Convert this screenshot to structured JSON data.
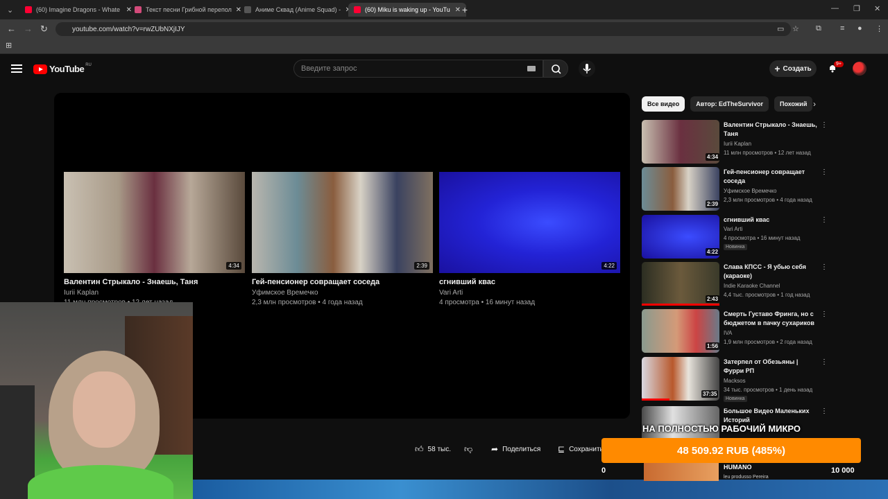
{
  "browser": {
    "tabs": [
      {
        "label": "(60) Imagine Dragons - Whate",
        "favcolor": "#ff0033",
        "active": false
      },
      {
        "label": "Текст песни Грибной перепол",
        "favcolor": "#d34b7a",
        "active": false
      },
      {
        "label": "Аниме Сквад (Anime Squad) -",
        "favcolor": "#2b2b2b",
        "active": false
      },
      {
        "label": "(60) Miku is waking up - YouTu",
        "favcolor": "#ff0033",
        "active": true
      }
    ],
    "url": "youtube.com/watch?v=rwZUbNXjIJY"
  },
  "header": {
    "logo_text": "YouTube",
    "region": "RU",
    "search_placeholder": "Введите запрос",
    "create_label": "Создать",
    "notif_badge": "9+"
  },
  "endcards": [
    {
      "title": "Валентин Стрыкало - Знаешь, Таня",
      "channel": "Iurii Kaplan",
      "meta": "11 млн просмотров • 12 лет назад",
      "duration": "4:34"
    },
    {
      "title": "Гей-пенсионер совращает соседа",
      "channel": "Уфимское Времечко",
      "meta": "2,3 млн просмотров • 4 года назад",
      "duration": "2:39"
    },
    {
      "title": "сгнивший квас",
      "channel": "Vari Arti",
      "meta": "4 просмотра • 16 минут назад",
      "duration": "4:22"
    }
  ],
  "actions": {
    "likes": "58 тыс.",
    "share": "Поделиться",
    "save": "Сохранить"
  },
  "chips": [
    "Все видео",
    "Автор: EdTheSurvivor",
    "Похожий"
  ],
  "recommendations": [
    {
      "title": "Валентин Стрыкало - Знаешь, Таня",
      "channel": "Iurii Kaplan",
      "meta": "11 млн просмотров • 12 лет назад",
      "duration": "4:34",
      "badge": ""
    },
    {
      "title": "Гей-пенсионер совращает соседа",
      "channel": "Уфимское Времечко",
      "meta": "2,3 млн просмотров • 4 года назад",
      "duration": "2:39",
      "badge": ""
    },
    {
      "title": "сгнивший квас",
      "channel": "Vari Arti",
      "meta": "4 просмотра • 16 минут назад",
      "duration": "4:22",
      "badge": "Новинка"
    },
    {
      "title": "Слава КПСС - Я убью себя (караоке)",
      "channel": "Indie Karaoke Channel",
      "meta": "4,4 тыс. просмотров • 1 год назад",
      "duration": "2:43",
      "badge": ""
    },
    {
      "title": "Смерть Густаво Фринга, но с бюджетом в пачку сухариков",
      "channel": "IVA",
      "meta": "1,9 млн просмотров • 2 года назад",
      "duration": "1:56",
      "badge": ""
    },
    {
      "title": "Затерпел от Обезьяны | Фурри РП",
      "channel": "Macksos",
      "meta": "34 тыс. просмотров • 1 день назад",
      "duration": "37:35",
      "badge": "Новинка"
    },
    {
      "title": "Большое Видео Маленьких Историй",
      "channel": "",
      "meta": "",
      "duration": "",
      "badge": ""
    }
  ],
  "overlay": {
    "donate_text": "НА ПОЛНОСТЬЮ РАБОЧИЙ МИКРО",
    "donate_amount": "48 509.92 RUB (485%)",
    "stat_left": "0",
    "stat_right": "10 000",
    "humano_title": "HUMANO",
    "humano_sub": "leu produsso Pereira"
  }
}
